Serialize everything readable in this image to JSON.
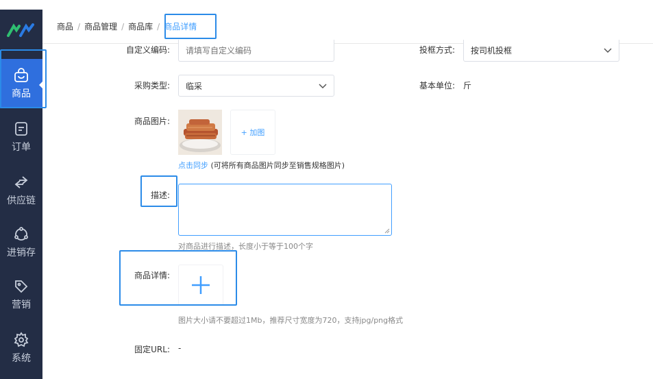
{
  "sidebar": {
    "logo": "app-logo",
    "items": [
      {
        "label": "商品",
        "icon": "shopping-bag-icon",
        "active": true
      },
      {
        "label": "订单",
        "icon": "order-doc-icon"
      },
      {
        "label": "供应链",
        "icon": "exchange-arrows-icon"
      },
      {
        "label": "进销存",
        "icon": "inventory-cycle-icon"
      },
      {
        "label": "营销",
        "icon": "tag-icon"
      },
      {
        "label": "系统",
        "icon": "gear-icon"
      }
    ]
  },
  "breadcrumb": [
    "商品",
    "商品管理",
    "商品库",
    "商品详情"
  ],
  "form": {
    "custom_code": {
      "label": "自定义编码:",
      "placeholder": "请填写自定义编码"
    },
    "frame_method": {
      "label": "投框方式:",
      "value": "按司机投框"
    },
    "purchase_type": {
      "label": "采购类型:",
      "value": "临采"
    },
    "base_unit": {
      "label": "基本单位:",
      "value": "斤"
    },
    "product_image": {
      "label": "商品图片:",
      "add_label": "+ 加图",
      "sync_link": "点击同步",
      "sync_note": "(可将所有商品图片同步至销售规格图片)"
    },
    "description": {
      "label": "描述:",
      "hint": "对商品进行描述，长度小于等于100个字"
    },
    "detail": {
      "label": "商品详情:",
      "hint": "图片大小请不要超过1Mb，推荐尺寸宽度为720，支持jpg/png格式"
    },
    "fixed_url": {
      "label": "固定URL:",
      "value": "-"
    }
  },
  "colors": {
    "sidebar_bg": "#232d45",
    "accent": "#409eff",
    "highlight": "#2b8be8",
    "active_nav": "#2f6fde"
  }
}
